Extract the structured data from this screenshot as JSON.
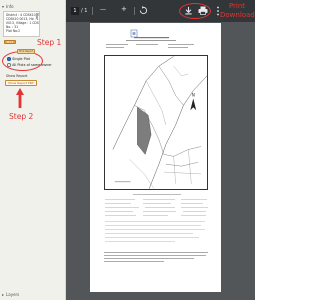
{
  "panel": {
    "header": "Info",
    "info_lines": [
      "District : 4 CDSK10, Taluk : 1",
      "CDSK10 0013, Hb : 1 CDSK10",
      "0013, Village : 1 CDSQ, Sheet",
      "No. : 31",
      "Plot No:2"
    ],
    "small_button": "Print",
    "oval_label": "Print Report",
    "radio_single": "Single Plot",
    "radio_all": "All Plots of same owner",
    "show_report": "Show Report",
    "pdf_button": "Show Report PDF",
    "footer": "Layers"
  },
  "annotations": {
    "step1": "Step 1",
    "step2": "Step 2",
    "print_download": "Print\nDownload",
    "accent": "#e23434"
  },
  "viewer": {
    "page_current": "1",
    "page_total": "/ 1",
    "zoom_out": "—",
    "zoom_in": "+",
    "icons": [
      "rotate-icon",
      "download-icon",
      "print-icon",
      "more-icon"
    ]
  }
}
